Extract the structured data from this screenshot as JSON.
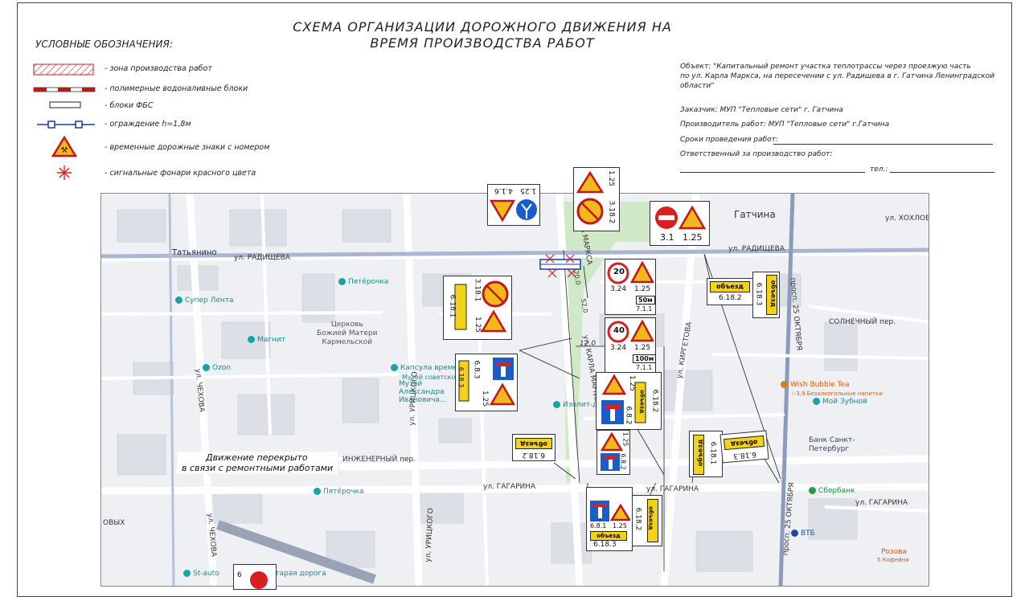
{
  "title": {
    "line1": "СХЕМА ОРГАНИЗАЦИИ ДОРОЖНОГО ДВИЖЕНИЯ НА",
    "line2": "ВРЕМЯ ПРОИЗВОДСТВА РАБОТ"
  },
  "legend": {
    "heading": "УСЛОВНЫЕ ОБОЗНАЧЕНИЯ:",
    "items": [
      "- зона производства работ",
      "- полимерные водоналивные блоки",
      "- блоки ФБС",
      "- ограждение h=1,8м",
      "- временные дорожные знаки с номером",
      "- сигнальные фонари красного цвета"
    ]
  },
  "info": {
    "object_line1": "Объект: \"Капитальный ремонт участка теплотрассы через проезжую часть",
    "object_line2": "по ул. Карла Маркса, на пересечении с ул. Радищева в г. Гатчина Ленинградской",
    "object_line3": "области\"",
    "customer": "Заказчик:  МУП \"Тепловые сети\" г. Гатчина",
    "contractor": "Производитель работ: МУП \"Тепловые сети\" г.Гатчина",
    "dates": "Сроки проведения работ:",
    "responsible": "Ответственный за производство работ:",
    "phone": "тел.:"
  },
  "map": {
    "streets": {
      "radishcheva_left": "ул. РАДИЩЕВА",
      "radishcheva_right": "ул. РАДИЩЕВА",
      "khokhlova": "ул. ХОХЛОВА",
      "karla_marksa_top": "ул. КАРЛА МАРКСА",
      "karla_marksa_mid": "ул. КАРЛА МАРКСА",
      "kirgetova": "ул. КИРГЕТОВА",
      "prosp25_top": "просп. 25 ОКТЯБРЯ",
      "prosp25_bottom": "просп. 25 ОКТЯБРЯ",
      "solnechny": "СОЛНЕЧНЫЙ пер.",
      "gagarina_left": "ул. ГАГАРИНА",
      "gagarina_mid": "ул. ГАГАРИНА",
      "gagarina_right": "ул. ГАГАРИНА",
      "inzhenerny": "ИНЖЕНЕРНЫЙ пер.",
      "chekhova_top": "ул. ЧЕХОВА",
      "chekhova_bottom": "ул. ЧЕХОВА",
      "uritskogo_top": "ул. УРИЦКОГО",
      "uritskogo_bottom": "ул. УРИЦКОГО",
      "gatchina": "Гатчина",
      "tatyanino": "Татьянино",
      "obvod": "ОВЫХ"
    },
    "pois": {
      "pyaterochka_top": "Пятёрочка",
      "super_lenta": "Супер Лента",
      "church": "Церковь\nБожией Матери\nКармельской",
      "magnit": "Магнит",
      "ozon": "Ozon",
      "kapsula": "Капсула времен",
      "muzey_sov": "Музей советской",
      "muzey_alex": "Музей\nАлександра\nИвановича...",
      "izolit": "Изолит-д",
      "wish": "Wish Bubble Tea",
      "wish_sub": "☆3,9 Безалкогольные напитки",
      "moy_zubnoy": "Мой Зубной",
      "bank": "Банк Санкт-\nПетербург",
      "sberbank": "Сбербанк",
      "pyaterochka_bottom": "Пятёрочка",
      "vtb": "ВТБ",
      "st_auto": "St-auto",
      "staraya": "Старая дорога",
      "rozova": "Розова",
      "koffeinya": "5 Кофейня"
    },
    "closed_note_line1": "Движение перекрыто",
    "closed_note_line2": "в связи с ремонтными работами",
    "dims": {
      "d1": "20,0",
      "d2": "52,0",
      "d3": "12,0"
    },
    "signs": {
      "s_top_left_a": "4.1.6",
      "s_top_left_b": "1.25",
      "s_top_mid_a": "3.18.2",
      "s_top_mid_b": "1.25",
      "s_top_right_a": "3.1",
      "s_top_right_b": "1.25",
      "s_left1_a": "3.18.1",
      "s_left1_b": "6.18.1",
      "s_left1_c": "1.25",
      "s_20": "20",
      "s_20_a": "3.24",
      "s_20_b": "1.25",
      "s_20_c": "50м",
      "s_20_d": "7.1.1",
      "s_40": "40",
      "s_40_a": "3.24",
      "s_40_b": "1.25",
      "s_40_c": "100м",
      "s_40_d": "7.1.1",
      "s_obezd_right1": "объезд",
      "s_obezd_right1_n": "6.18.2",
      "s_obezd_right2": "объезд",
      "s_obezd_right2_n": "6.18.3",
      "s_left2_a": "6.8.3",
      "s_left2_b": "6.18.3",
      "s_left2_c": "1.25",
      "s_mid1_a": "1.25",
      "s_mid1_b": "6.8.2",
      "s_mid1_c": "6.18.2",
      "s_mid1_obezd": "объезд",
      "s_mid2_a": "1.25",
      "s_mid2_b": "6.8.2",
      "s_lower_left": "6.18.2",
      "s_lower_left_obezd": "объезд",
      "s_right3_a": "6.18.1",
      "s_right3_obezd": "объезд",
      "s_right4_a": "6.18.3",
      "s_right4_obezd": "объезд",
      "s_bottom_a": "6.8.1",
      "s_bottom_b": "1.25",
      "s_bottom_c": "6.18.3",
      "s_bottom_d": "6.18.2",
      "s_bottom_obezd": "объезд",
      "s_bottom_obezd2": "объезд",
      "s_bottom_left_num": "6"
    }
  }
}
